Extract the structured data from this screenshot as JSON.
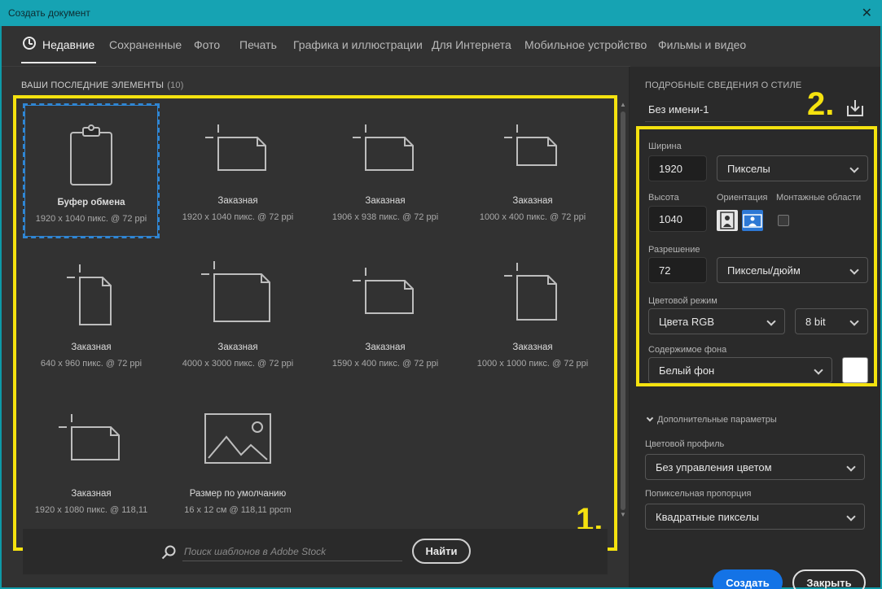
{
  "window": {
    "title": "Создать документ",
    "close_glyph": "✕"
  },
  "tabs": [
    {
      "label": "Недавние",
      "active": true
    },
    {
      "label": "Сохраненные"
    },
    {
      "label": "Фото"
    },
    {
      "label": "Печать"
    },
    {
      "label": "Графика и иллюстрации"
    },
    {
      "label": "Для Интернета"
    },
    {
      "label": "Мобильное устройство"
    },
    {
      "label": "Фильмы и видео"
    }
  ],
  "recent": {
    "title": "ВАШИ ПОСЛЕДНИЕ ЭЛЕМЕНТЫ",
    "count": "(10)",
    "items": [
      {
        "name": "Буфер обмена",
        "dims": "1920 x 1040 пикс. @ 72 ppi",
        "icon": "clipboard-icon",
        "selected": true
      },
      {
        "name": "Заказная",
        "dims": "1920 x 1040 пикс. @ 72 ppi",
        "icon": "document-icon"
      },
      {
        "name": "Заказная",
        "dims": "1906 x 938 пикс. @ 72 ppi",
        "icon": "document-icon"
      },
      {
        "name": "Заказная",
        "dims": "1000 x 400 пикс. @ 72 ppi",
        "icon": "document-icon"
      },
      {
        "name": "Заказная",
        "dims": "640 x 960 пикс. @ 72 ppi",
        "icon": "document-icon"
      },
      {
        "name": "Заказная",
        "dims": "4000 x 3000 пикс. @ 72 ppi",
        "icon": "document-icon"
      },
      {
        "name": "Заказная",
        "dims": "1590 x 400 пикс. @ 72 ppi",
        "icon": "document-icon"
      },
      {
        "name": "Заказная",
        "dims": "1000 x 1000 пикс. @ 72 ppi",
        "icon": "document-icon"
      },
      {
        "name": "Заказная",
        "dims": "1920 x 1080 пикс. @ 118,11",
        "icon": "document-icon"
      },
      {
        "name": "Размер по умолчанию",
        "dims": "16 x 12 см @ 118,11 ppcm",
        "icon": "image-icon"
      }
    ]
  },
  "annotations": {
    "label_1": "1.",
    "label_2": "2."
  },
  "search": {
    "placeholder": "Поиск шаблонов в Adobe Stock",
    "button": "Найти"
  },
  "details": {
    "title": "ПОДРОБНЫЕ СВЕДЕНИЯ О СТИЛЕ",
    "doc_name": "Без имени-1",
    "width_label": "Ширина",
    "width_value": "1920",
    "width_unit": "Пикселы",
    "height_label": "Высота",
    "height_value": "1040",
    "orientation_label": "Ориентация",
    "artboards_label": "Монтажные области",
    "resolution_label": "Разрешение",
    "resolution_value": "72",
    "resolution_unit": "Пикселы/дюйм",
    "color_mode_label": "Цветовой режим",
    "color_mode": "Цвета RGB",
    "bit_depth": "8 bit",
    "background_label": "Содержимое фона",
    "background": "Белый фон",
    "background_color": "#ffffff",
    "advanced_label": "Дополнительные параметры",
    "profile_label": "Цветовой профиль",
    "profile": "Без управления цветом",
    "pixel_aspect_label": "Попиксельная пропорция",
    "pixel_aspect": "Квадратные пикселы",
    "create_button": "Создать",
    "close_button": "Закрыть"
  },
  "colors": {
    "accent": "#1473e6",
    "highlight": "#f5e20f",
    "titlebar": "#16a3b3",
    "selection": "#2f86d4"
  }
}
